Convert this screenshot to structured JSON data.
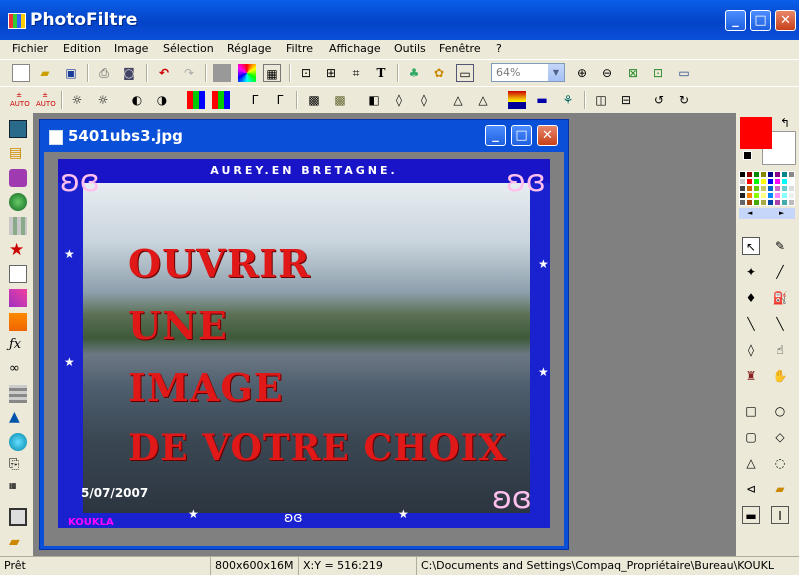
{
  "app": {
    "title": "PhotoFiltre",
    "window_buttons": {
      "minimize": "_",
      "maximize": "□",
      "close": "✕"
    }
  },
  "menu": [
    "Fichier",
    "Edition",
    "Image",
    "Sélection",
    "Réglage",
    "Filtre",
    "Affichage",
    "Outils",
    "Fenêtre",
    "?"
  ],
  "toolbar1": {
    "zoom_value": "64%",
    "text_tool_label": "T"
  },
  "toolbar2": {
    "auto_label_1": "AUTO",
    "auto_label_2": "AUTO"
  },
  "document": {
    "title": "5401ubs3.jpg",
    "image": {
      "banner": "AUREY.EN BRETAGNE.",
      "overlay_lines": [
        "OUVRIR",
        "UNE",
        "IMAGE",
        "DE VOTRE CHOIX"
      ],
      "date": "5/07/2007",
      "signature": "KOUKLA"
    }
  },
  "colors": {
    "foreground": "#ff0000",
    "background": "#ffffff",
    "titlebar": "#0a4fd8"
  },
  "palette_nav": {
    "prev": "◄",
    "next": "►"
  },
  "status": {
    "state": "Prêt",
    "size": "800x600x16M",
    "coords": "X:Y = 516:219",
    "path": "C:\\Documents and Settings\\Compaq_Propriétaire\\Bureau\\KOUKL"
  }
}
